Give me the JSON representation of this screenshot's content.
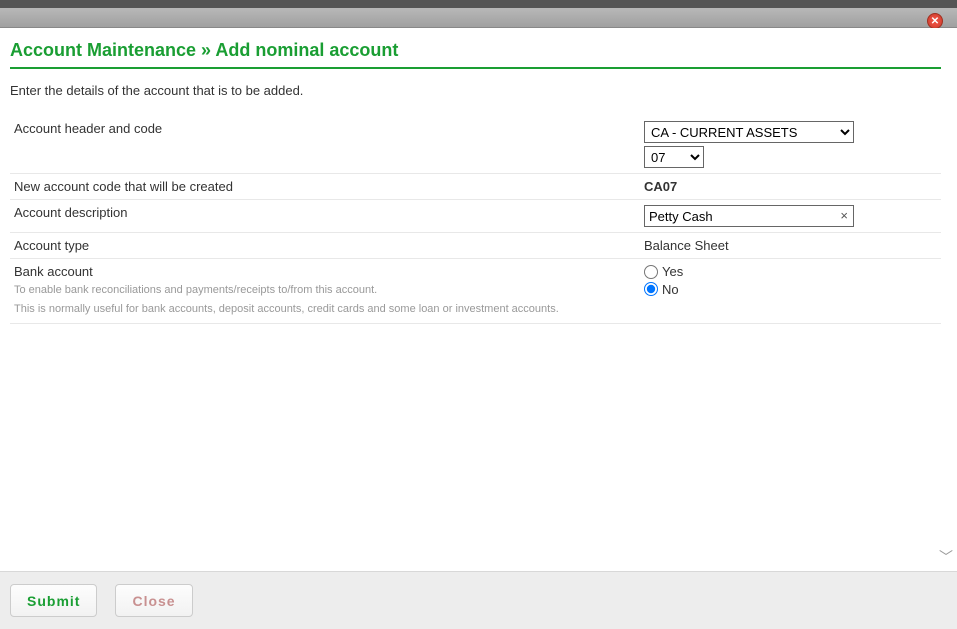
{
  "breadcrumb": {
    "main": "Account Maintenance",
    "separator": "»",
    "sub": "Add nominal account"
  },
  "intro": "Enter the details of the account that is to be added.",
  "rows": {
    "header_code": {
      "label": "Account header and code",
      "header_selected": "CA - CURRENT ASSETS",
      "code_selected": "07"
    },
    "new_code": {
      "label": "New account code that will be created",
      "value": "CA07"
    },
    "description": {
      "label": "Account description",
      "value": "Petty Cash"
    },
    "type": {
      "label": "Account type",
      "value": "Balance Sheet"
    },
    "bank": {
      "label": "Bank account",
      "help1": "To enable bank reconciliations and payments/receipts to/from this account.",
      "help2": "This is normally useful for bank accounts, deposit accounts, credit cards and some loan or investment accounts.",
      "yes": "Yes",
      "no": "No"
    }
  },
  "buttons": {
    "submit": "Submit",
    "close": "Close"
  }
}
